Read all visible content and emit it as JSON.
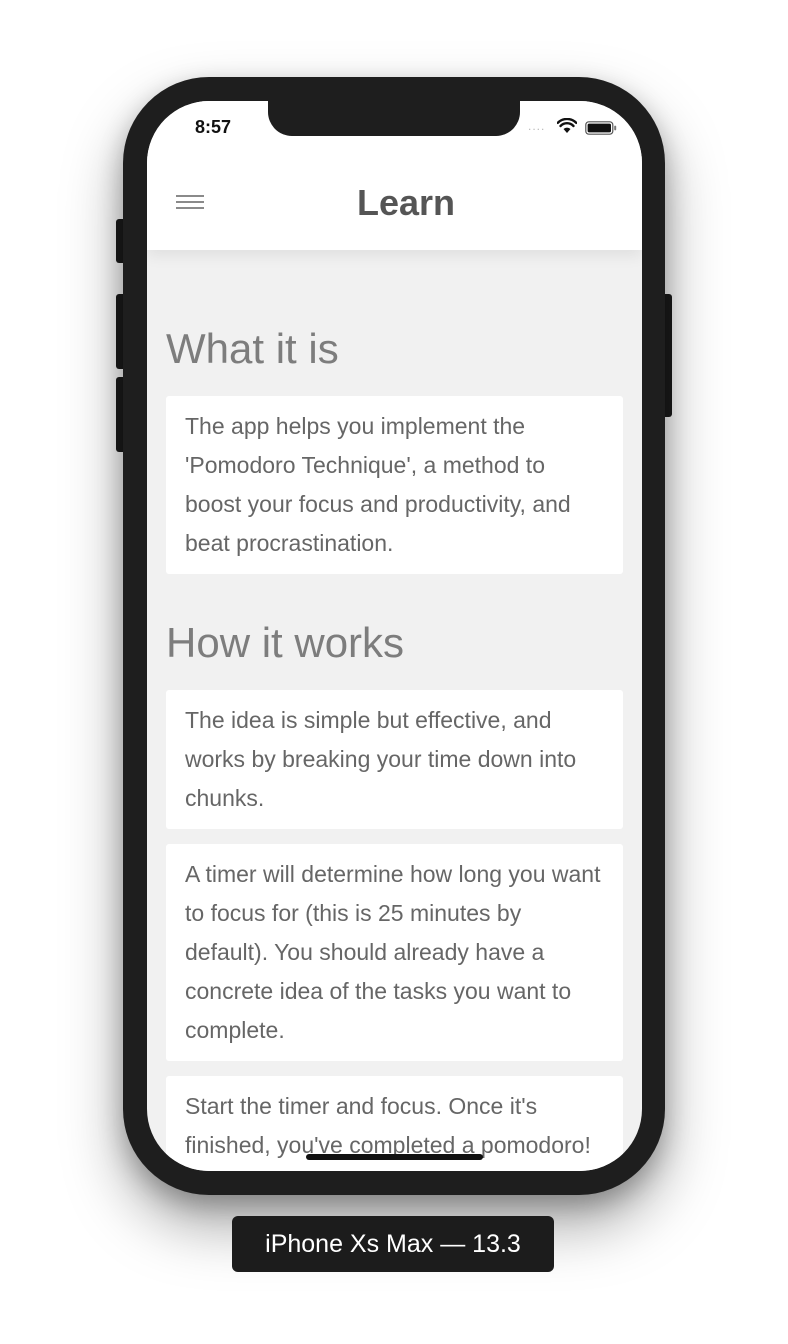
{
  "status_bar": {
    "time": "8:57",
    "signal": "....",
    "wifi_icon": "wifi-icon",
    "battery_icon": "battery-icon"
  },
  "nav": {
    "title": "Learn",
    "menu_icon": "hamburger-menu-icon"
  },
  "sections": [
    {
      "title": "What it is",
      "cards": [
        "The app helps you implement the 'Pomodoro Technique', a method to boost your focus and productivity, and beat procrastination."
      ]
    },
    {
      "title": "How it works",
      "cards": [
        "The idea is simple but effective, and works by breaking your time down into chunks.",
        "A timer will determine how long you want to focus for (this is 25 minutes by default). You should already have a concrete idea of the tasks you want to complete.",
        "Start the timer and focus. Once it's finished, you've completed a pomodoro!"
      ]
    }
  ],
  "device_label": "iPhone Xs Max — 13.3"
}
